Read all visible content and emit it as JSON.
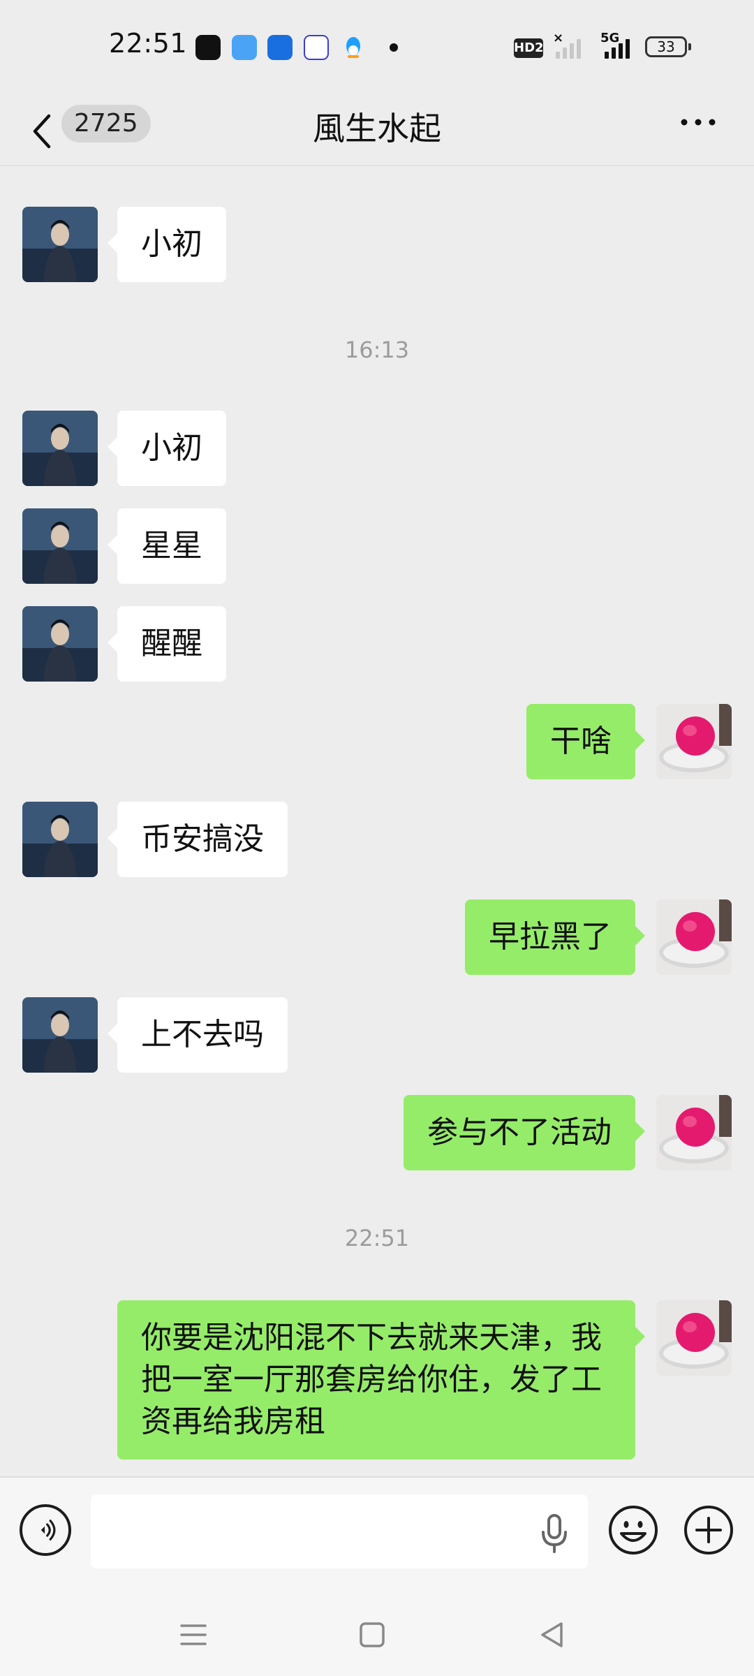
{
  "status_bar": {
    "time": "22:51",
    "battery": "33",
    "network": "5G",
    "hd_label": "HD2",
    "app_icons": [
      "douyin-icon",
      "weather-icon",
      "autohome-icon",
      "tieba-icon",
      "qq-icon"
    ]
  },
  "header": {
    "back_icon": "chevron-left-icon",
    "unread_count": "2725",
    "title": "風生水起",
    "more_icon": "more-horizontal-icon"
  },
  "messages": [
    {
      "side": "in",
      "text": "小初"
    },
    {
      "type": "time",
      "text": "16:13"
    },
    {
      "side": "in",
      "text": "小初"
    },
    {
      "side": "in",
      "text": "星星"
    },
    {
      "side": "in",
      "text": "醒醒"
    },
    {
      "side": "out",
      "text": "干啥"
    },
    {
      "side": "in",
      "text": "币安搞没"
    },
    {
      "side": "out",
      "text": "早拉黑了"
    },
    {
      "side": "in",
      "text": "上不去吗"
    },
    {
      "side": "out",
      "text": "参与不了活动"
    },
    {
      "type": "time",
      "text": "22:51"
    },
    {
      "side": "out",
      "text": "你要是沈阳混不下去就来天津，我把一室一厅那套房给你住，发了工资再给我房租"
    }
  ],
  "input_bar": {
    "placeholder": "",
    "voice_icon": "voice-icon",
    "mic_icon": "mic-icon",
    "emoji_icon": "emoji-icon",
    "plus_icon": "plus-icon"
  },
  "colors": {
    "background": "#ededed",
    "incoming_bubble": "#ffffff",
    "outgoing_bubble": "#95ec69",
    "timestamp_text": "#9b9b9b"
  }
}
